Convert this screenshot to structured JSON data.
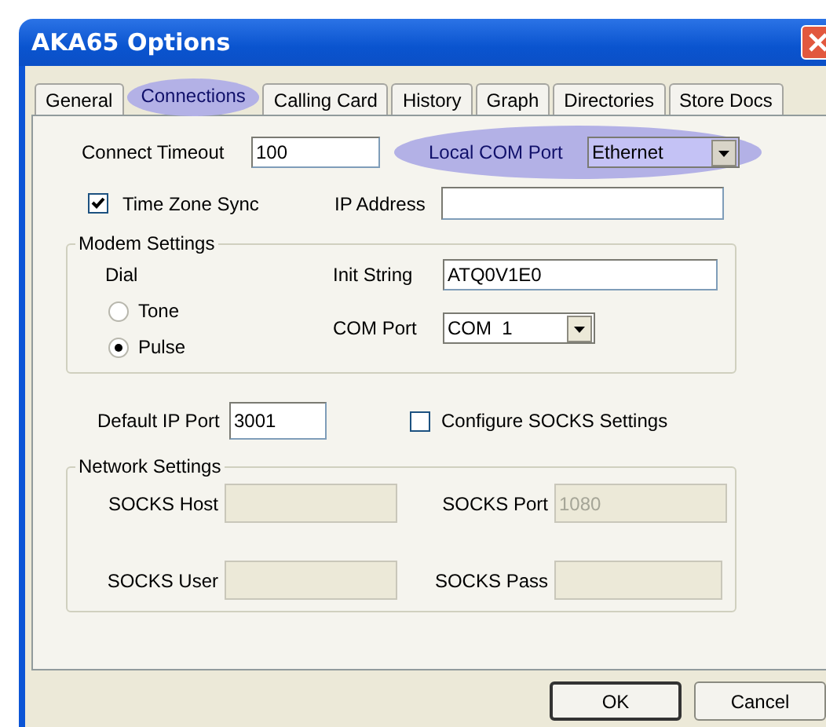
{
  "window": {
    "title": "AKA65 Options"
  },
  "tabs": [
    {
      "label": "General",
      "selected": false,
      "highlighted": false
    },
    {
      "label": "Connections",
      "selected": true,
      "highlighted": true
    },
    {
      "label": "Calling Card",
      "selected": false,
      "highlighted": false
    },
    {
      "label": "History",
      "selected": false,
      "highlighted": false
    },
    {
      "label": "Graph",
      "selected": false,
      "highlighted": false
    },
    {
      "label": "Directories",
      "selected": false,
      "highlighted": false
    },
    {
      "label": "Store Docs",
      "selected": false,
      "highlighted": false
    }
  ],
  "connect_timeout": {
    "label": "Connect Timeout",
    "value": "100"
  },
  "local_com_port": {
    "label": "Local COM Port",
    "value": "Ethernet",
    "highlighted": true
  },
  "time_zone_sync": {
    "label": "Time Zone Sync",
    "checked": true
  },
  "ip_address": {
    "label": "IP Address"
  },
  "modem_settings": {
    "title": "Modem Settings",
    "dial_label": "Dial",
    "dial_options": [
      {
        "label": "Tone",
        "selected": false
      },
      {
        "label": "Pulse",
        "selected": true
      }
    ],
    "init_string": {
      "label": "Init String",
      "value": "ATQ0V1E0"
    },
    "com_port": {
      "label": "COM Port",
      "value": "COM  1"
    }
  },
  "default_ip_port": {
    "label": "Default IP Port",
    "value": "3001"
  },
  "configure_socks": {
    "label": "Configure SOCKS Settings",
    "checked": false
  },
  "network_settings": {
    "title": "Network Settings",
    "fields": [
      {
        "label": "SOCKS Host",
        "disabled": true
      },
      {
        "label": "SOCKS Port",
        "value": "1080",
        "disabled": true
      },
      {
        "label": "SOCKS User",
        "disabled": true
      },
      {
        "label": "SOCKS Pass",
        "disabled": true
      }
    ]
  },
  "buttons": [
    {
      "label": "OK",
      "default": true
    },
    {
      "label": "Cancel",
      "default": false
    }
  ]
}
